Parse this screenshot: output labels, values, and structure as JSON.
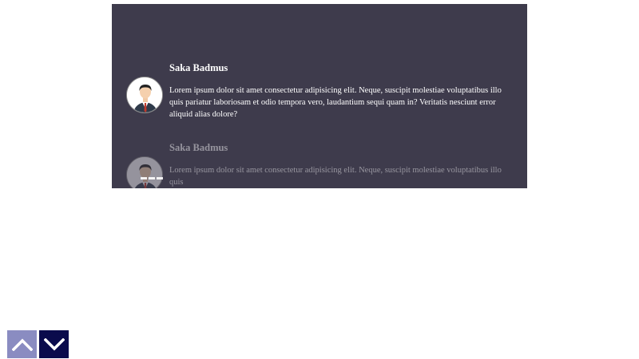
{
  "testimonials": [
    {
      "name": "Saka Badmus",
      "quote": "Lorem ipsum dolor sit amet consectetur adipisicing elit. Neque, suscipit molestiae voluptatibus illo quis pariatur laboriosam et odio tempora vero, laudantium sequi quam in? Veritatis nesciunt error aliquid alias dolore?"
    },
    {
      "name": "Saka Badmus",
      "quote": "Lorem ipsum dolor sit amet consectetur adipisicing elit. Neque, suscipit molestiae voluptatibus illo quis"
    }
  ],
  "slider": {
    "dot_count": 3
  },
  "nav": {
    "up_icon": "chevron-up-icon",
    "down_icon": "chevron-down-icon"
  },
  "colors": {
    "panel_bg": "#3e3b4c",
    "up_button_bg": "#8a8cc1",
    "down_button_bg": "#0a0b4c",
    "text": "#ffffff"
  }
}
